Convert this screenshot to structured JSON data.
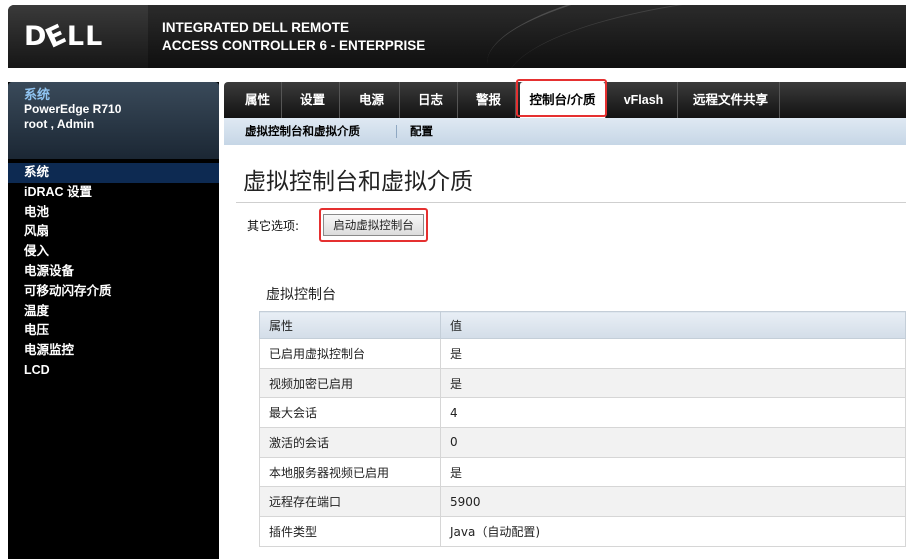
{
  "header": {
    "logo": "DELL",
    "product_line1": "INTEGRATED DELL REMOTE",
    "product_line2": "ACCESS CONTROLLER 6 - ENTERPRISE"
  },
  "sidebar": {
    "system_title": "系统",
    "model": "PowerEdge R710",
    "user": "root , Admin",
    "items": [
      {
        "label": "系统",
        "active": true
      },
      {
        "label": "iDRAC 设置",
        "active": false
      },
      {
        "label": "电池",
        "active": false
      },
      {
        "label": "风扇",
        "active": false
      },
      {
        "label": "侵入",
        "active": false
      },
      {
        "label": "电源设备",
        "active": false
      },
      {
        "label": "可移动闪存介质",
        "active": false
      },
      {
        "label": "温度",
        "active": false
      },
      {
        "label": "电压",
        "active": false
      },
      {
        "label": "电源监控",
        "active": false
      },
      {
        "label": "LCD",
        "active": false
      }
    ]
  },
  "tabs": [
    {
      "label": "属性",
      "active": false
    },
    {
      "label": "设置",
      "active": false
    },
    {
      "label": "电源",
      "active": false
    },
    {
      "label": "日志",
      "active": false
    },
    {
      "label": "警报",
      "active": false
    },
    {
      "label": "控制台/介质",
      "active": true
    },
    {
      "label": "vFlash",
      "active": false
    },
    {
      "label": "远程文件共享",
      "active": false
    }
  ],
  "subtabs": [
    {
      "label": "虚拟控制台和虚拟介质",
      "active": true
    },
    {
      "label": "配置",
      "active": false
    }
  ],
  "page": {
    "title": "虚拟控制台和虚拟介质",
    "other_options_label": "其它选项:",
    "launch_button": "启动虚拟控制台",
    "section_title": "虚拟控制台"
  },
  "table": {
    "headers": [
      "属性",
      "值"
    ],
    "rows": [
      [
        "已启用虚拟控制台",
        "是"
      ],
      [
        "视频加密已启用",
        "是"
      ],
      [
        "最大会话",
        "4"
      ],
      [
        "激活的会话",
        "0"
      ],
      [
        "本地服务器视频已启用",
        "是"
      ],
      [
        "远程存在端口",
        "5900"
      ],
      [
        "插件类型",
        "Java（自动配置)"
      ]
    ]
  },
  "colors": {
    "highlight": "#e53030",
    "nav_active": "#0d2a52",
    "system_title": "#8fc3f0"
  }
}
